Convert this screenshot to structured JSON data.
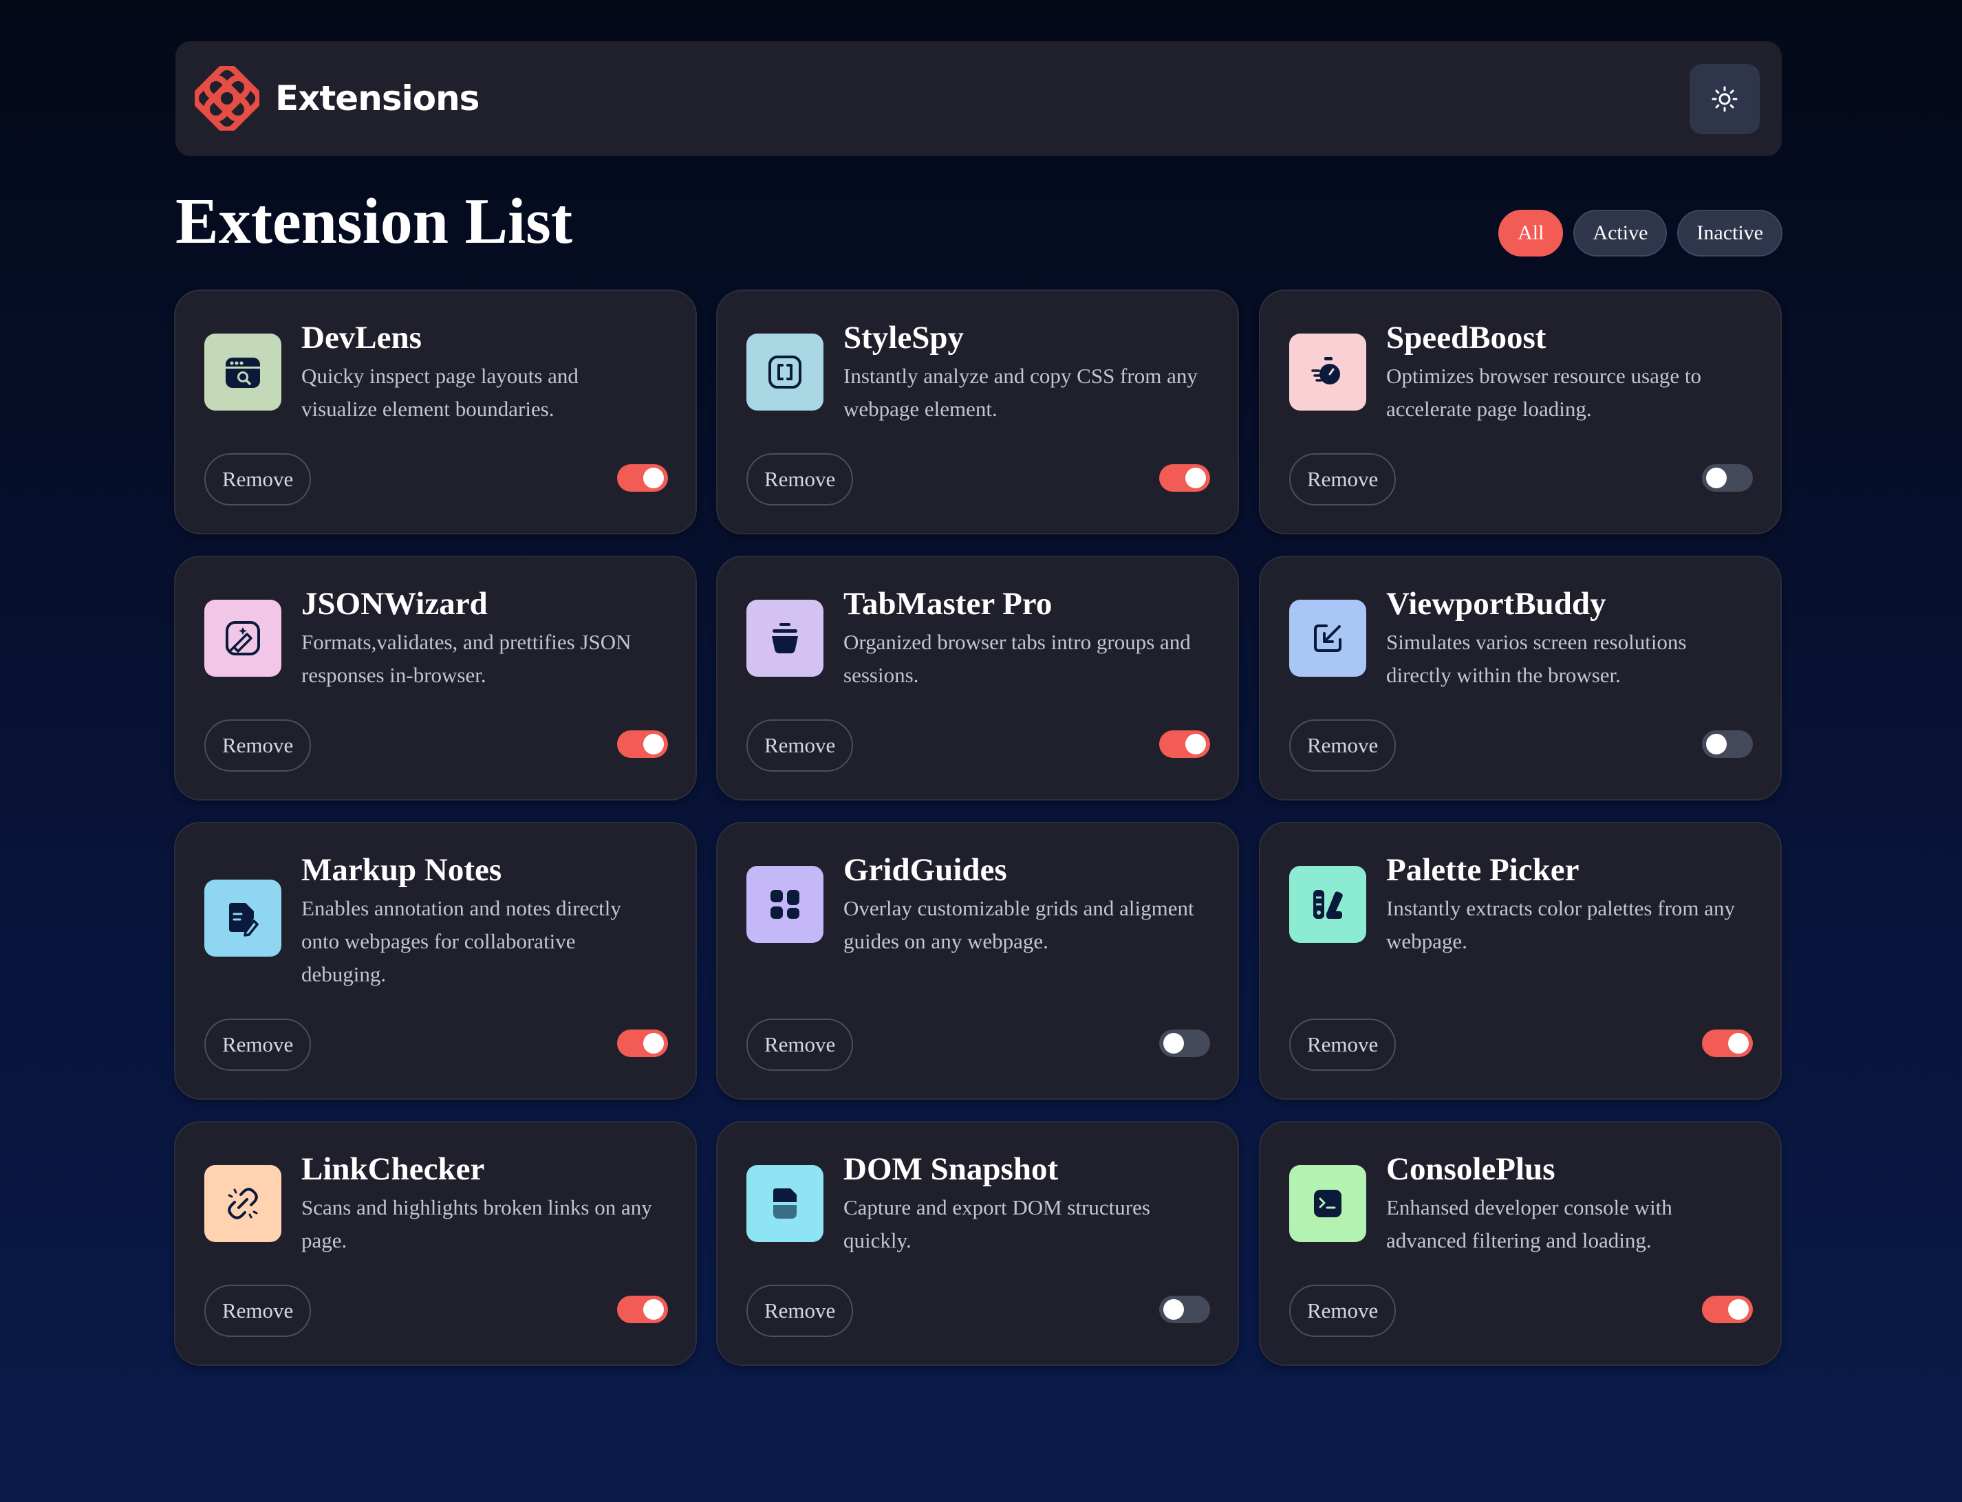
{
  "header": {
    "brand": "Extensions",
    "logo_icon": "extensions-logo-icon",
    "theme_icon": "sun-icon"
  },
  "list": {
    "title": "Extension List"
  },
  "filters": [
    {
      "label": "All",
      "selected": true
    },
    {
      "label": "Active",
      "selected": false
    },
    {
      "label": "Inactive",
      "selected": false
    }
  ],
  "colors": {
    "accent": "#f25c54",
    "card_bg": "#1f202c",
    "page_bg": "#040918"
  },
  "extensions": [
    {
      "name": "DevLens",
      "description": "Quicky inspect page layouts and visualize element boundaries.",
      "icon": "devlens-icon",
      "icon_bg": "#c3d9b8",
      "active": true,
      "remove_label": "Remove"
    },
    {
      "name": "StyleSpy",
      "description": "Instantly analyze and copy CSS from any webpage element.",
      "icon": "stylespy-icon",
      "icon_bg": "#a9d8e4",
      "active": true,
      "remove_label": "Remove"
    },
    {
      "name": "SpeedBoost",
      "description": "Optimizes browser resource usage to accelerate page loading.",
      "icon": "speedboost-icon",
      "icon_bg": "#f9d0d3",
      "active": false,
      "remove_label": "Remove"
    },
    {
      "name": "JSONWizard",
      "description": "Formats,validates, and prettifies JSON responses in-browser.",
      "icon": "jsonwizard-icon",
      "icon_bg": "#f1c6e6",
      "active": true,
      "remove_label": "Remove"
    },
    {
      "name": "TabMaster Pro",
      "description": "Organized browser tabs intro groups and sessions.",
      "icon": "tabmaster-icon",
      "icon_bg": "#d4c3f2",
      "active": true,
      "remove_label": "Remove"
    },
    {
      "name": "ViewportBuddy",
      "description": "Simulates varios screen resolutions directly within the browser.",
      "icon": "viewportbuddy-icon",
      "icon_bg": "#a9c7f6",
      "active": false,
      "remove_label": "Remove"
    },
    {
      "name": "Markup Notes",
      "description": "Enables annotation and notes directly onto webpages for collaborative debuging.",
      "icon": "markupnotes-icon",
      "icon_bg": "#8ed6f2",
      "active": true,
      "remove_label": "Remove"
    },
    {
      "name": "GridGuides",
      "description": "Overlay customizable grids and aligment guides on any webpage.",
      "icon": "gridguides-icon",
      "icon_bg": "#c5b8f9",
      "active": false,
      "remove_label": "Remove"
    },
    {
      "name": "Palette Picker",
      "description": "Instantly extracts color palettes from any webpage.",
      "icon": "palettepicker-icon",
      "icon_bg": "#8cecd2",
      "active": true,
      "remove_label": "Remove"
    },
    {
      "name": "LinkChecker",
      "description": "Scans and highlights broken links on any page.",
      "icon": "linkchecker-icon",
      "icon_bg": "#ffd3b0",
      "active": true,
      "remove_label": "Remove"
    },
    {
      "name": "DOM Snapshot",
      "description": "Capture and export DOM structures quickly.",
      "icon": "domsnapshot-icon",
      "icon_bg": "#8ee4f2",
      "active": false,
      "remove_label": "Remove"
    },
    {
      "name": "ConsolePlus",
      "description": "Enhansed developer console with advanced filtering and loading.",
      "icon": "consoleplus-icon",
      "icon_bg": "#b4f2b2",
      "active": true,
      "remove_label": "Remove"
    }
  ]
}
